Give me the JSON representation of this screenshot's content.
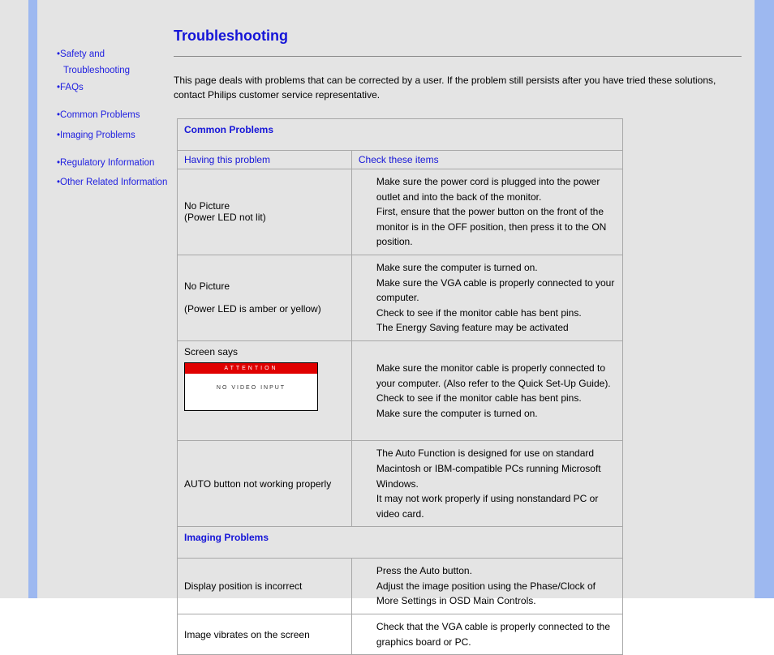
{
  "sidebar": {
    "safety": "Safety and",
    "safety2": "Troubleshooting",
    "faqs": "FAQs",
    "common": "Common Problems",
    "imaging": "Imaging Problems",
    "regulatory": "Regulatory Information",
    "other": "Other Related Information"
  },
  "title": "Troubleshooting",
  "intro": "This page deals with problems that can be corrected by a user. If the problem still persists after you have tried these solutions, contact Philips customer service representative.",
  "sections": {
    "common_hd": "Common Problems",
    "imaging_hd": "Imaging Problems",
    "col_left": "Having this problem",
    "col_right": "Check these items"
  },
  "rows": {
    "r1l_a": "No Picture",
    "r1l_b": "(Power LED not lit)",
    "r1r_a": "Make sure the power cord is plugged into the power outlet and into the back of the monitor.",
    "r1r_b": "First, ensure that the power button on the front of the monitor is in the OFF position, then press it to the ON position.",
    "r2l_a": "No Picture",
    "r2l_b": "(Power LED is amber or yellow)",
    "r2r_a": "Make sure the computer is turned on.",
    "r2r_b": "Make sure the VGA cable is properly connected to your computer.",
    "r2r_c": "Check to see if the monitor cable has bent pins.",
    "r2r_d": "The Energy Saving feature may be activated",
    "r3l": "Screen says",
    "r3_attn_hd": "ATTENTION",
    "r3_attn_body": "NO VIDEO INPUT",
    "r3r_a": "Make sure the monitor cable is properly connected to your computer. (Also refer to the Quick Set-Up Guide).",
    "r3r_b": "Check to see if the monitor cable has bent pins.",
    "r3r_c": "Make sure the computer is turned on.",
    "r4l": "AUTO button not working properly",
    "r4r_a": "The Auto Function is designed for use on standard Macintosh or IBM-compatible PCs running Microsoft Windows.",
    "r4r_b": "It may not work properly if using nonstandard PC or video card.",
    "r5l": "Display position is incorrect",
    "r5r_a": "Press the Auto button.",
    "r5r_b": "Adjust the image position using the Phase/Clock of More Settings in OSD Main Controls.",
    "r6l": "Image vibrates on the screen",
    "r6r": "Check that the VGA cable is properly connected to the graphics board or PC."
  }
}
